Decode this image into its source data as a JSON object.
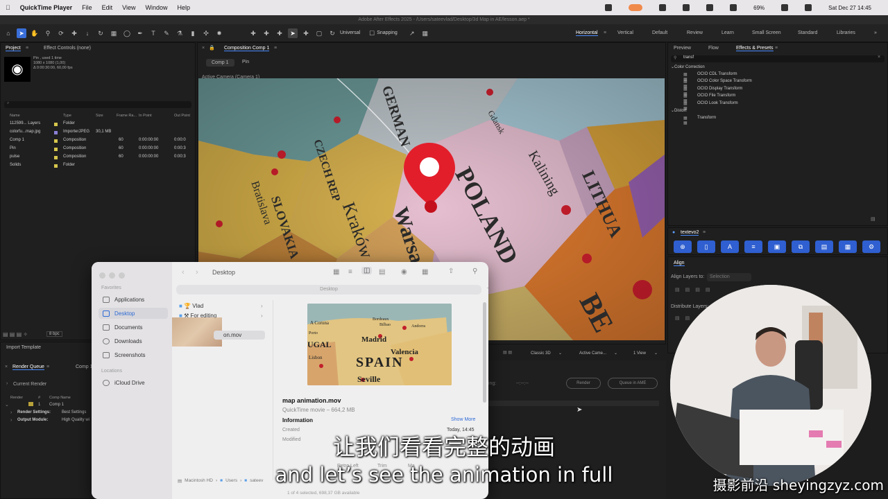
{
  "menubar": {
    "app": "QuickTime Player",
    "items": [
      "File",
      "Edit",
      "View",
      "Window",
      "Help"
    ],
    "battery": "69%",
    "datetime": "Sat Dec 27  14:45"
  },
  "window_title": "Adobe After Effects 2025 - /Users/sateevlad/Desktop/3d Map in AE/lesson.aep *",
  "toolbar": {
    "universal": "Universal",
    "snapping": "Snapping"
  },
  "workspaces": [
    "Horizontal",
    "Vertical",
    "Default",
    "Review",
    "Learn",
    "Small Screen",
    "Standard",
    "Libraries"
  ],
  "project_panel": {
    "tab": "Project",
    "tab2": "Effect Controls (none)",
    "item_name": "Pin , used 1 time",
    "item_res": "1080 x 1080 (1,00)",
    "item_dur": "Δ 0:00:30:00, 60,00 fps",
    "search_placeholder": "⌕",
    "columns": [
      "Name",
      "Type",
      "Size",
      "Frame Ra...",
      "In Point",
      "Out Point"
    ],
    "rows": [
      {
        "name": "112599... Layers",
        "type": "Folder",
        "size": "",
        "fps": "",
        "in": "",
        "out": "",
        "color": "#d6c64c"
      },
      {
        "name": "colorfu...map.jpg",
        "type": "ImporterJPEG",
        "size": "30,1 MB",
        "fps": "",
        "in": "",
        "out": "",
        "color": "#8a7fd6"
      },
      {
        "name": "Comp 1",
        "type": "Composition",
        "size": "",
        "fps": "60",
        "in": "0:00:00:00",
        "out": "0:00:0",
        "color": "#d6c64c"
      },
      {
        "name": "Pin",
        "type": "Composition",
        "size": "",
        "fps": "60",
        "in": "0:00:00:00",
        "out": "0:00:3",
        "color": "#d6c64c"
      },
      {
        "name": "pulse",
        "type": "Composition",
        "size": "",
        "fps": "60",
        "in": "0:00:00:00",
        "out": "0:00:3",
        "color": "#d6c64c"
      },
      {
        "name": "Solids",
        "type": "Folder",
        "size": "",
        "fps": "",
        "in": "",
        "out": "",
        "color": "#d6c64c"
      }
    ],
    "bpc": "8 bpc"
  },
  "comp_panel": {
    "tab": "Composition Comp 1",
    "crumbs": [
      "Comp 1",
      "Pin"
    ],
    "camera": "Active Camera (Camera 1)",
    "renderer": "Classic 3D",
    "view": "Active Came...",
    "views": "1 View"
  },
  "effects_panel": {
    "tabs": [
      "Preview",
      "Flow",
      "Effects & Presets"
    ],
    "search": "transf",
    "groups": [
      {
        "name": "Color Correction",
        "items": [
          "OCIO CDL Transform",
          "OCIO Color Space Transform",
          "OCIO Display Transform",
          "OCIO File Transform",
          "OCIO Look Transform"
        ]
      },
      {
        "name": "Distort",
        "items": [
          "Transform"
        ]
      }
    ]
  },
  "textevo": {
    "title": "textevo2"
  },
  "align_panel": {
    "title": "Align",
    "align_to_label": "Align Layers to:",
    "align_to_value": "Selection",
    "distribute": "Distribute Layers:"
  },
  "render_queue": {
    "import_template": "Import Template",
    "tab": "Render Queue",
    "tab2": "Comp 1",
    "current_render": "Current Render",
    "cols": [
      "Render",
      "#",
      "Comp Name"
    ],
    "item": {
      "num": "1",
      "name": "Comp 1"
    },
    "render_settings_label": "Render Settings:",
    "render_settings_value": "Best Settings",
    "output_module_label": "Output Module:",
    "output_module_value": "High Quality wi",
    "remaining": "ing:",
    "remaining_value": "--:--:--",
    "render_btn": "Render",
    "queue_ame_btn": "Queue in AME"
  },
  "finder": {
    "title": "Desktop",
    "path_title": "Desktop",
    "favorites_header": "Favorites",
    "favorites": [
      "Applications",
      "Desktop",
      "Documents",
      "Downloads",
      "Screenshots"
    ],
    "locations_header": "Locations",
    "locations": [
      "iCloud Drive"
    ],
    "folder_items": [
      "Vlad",
      "For editing"
    ],
    "selected_file": "on.mov",
    "preview_labels": [
      "A Coruna",
      "Bordeaux",
      "Bilbao",
      "Andorra",
      "UGAL",
      "Madrid",
      "Porto",
      "Valencia",
      "SPAIN",
      "Lisbon",
      "Seville"
    ],
    "file_name": "map animation.mov",
    "file_kind": "QuickTime movie – 664,2 MB",
    "info_header": "Information",
    "show_more": "Show More",
    "created_label": "Created",
    "created_value": "Today, 14:45",
    "modified_label": "Modified",
    "partial_labels": [
      "Retro Left",
      "Trim",
      "Ma"
    ],
    "breadcrumb": [
      "Macintosh HD",
      "Users",
      "sateev"
    ],
    "status": "1 of 4 selected, 698,37 GB available"
  },
  "map_labels": [
    "POLAND",
    "Warsaw",
    "Kraków",
    "Kalining",
    "LITHUA",
    "Gdansk",
    "GERMAN",
    "CZECH REP",
    "SLOVAKIA",
    "Bratislava",
    "BE"
  ],
  "subtitles": {
    "cn": "让我们看看完整的动画",
    "en": "and let’s see the animation in full"
  },
  "watermark": "摄影前沿 sheyingzyz.com"
}
